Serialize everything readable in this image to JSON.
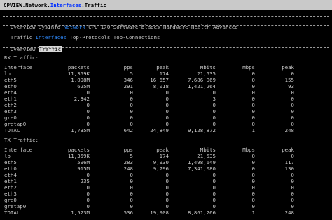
{
  "title": {
    "prefix": "CPVIEW.Network.",
    "highlight": "Interfaces",
    "suffix": ".Traffic"
  },
  "menu1": {
    "before": "Overview SysInfo ",
    "selected": "Network",
    "after": " CPU I/O Software-blades Hardware-Health Advanced"
  },
  "menu2": {
    "before": "Traffic ",
    "selected": "Interfaces",
    "after": " Top-Protocols Top-Connections"
  },
  "menu3": {
    "before": "Overview ",
    "selected": "Traffic"
  },
  "headers": [
    "Interface",
    "packets",
    "pps",
    "peak",
    "Mbits",
    "Mbps",
    "peak"
  ],
  "rx": {
    "label": "RX Traffic:",
    "rows": [
      [
        "lo",
        "11,359K",
        "5",
        "174",
        "21,535",
        "0",
        "0"
      ],
      [
        "eth5",
        "1,098M",
        "346",
        "16,657",
        "7,686,069",
        "0",
        "155"
      ],
      [
        "eth0",
        "625M",
        "291",
        "8,018",
        "1,421,264",
        "0",
        "93"
      ],
      [
        "eth4",
        "0",
        "0",
        "0",
        "0",
        "0",
        "0"
      ],
      [
        "eth1",
        "2,342",
        "0",
        "0",
        "3",
        "0",
        "0"
      ],
      [
        "eth2",
        "0",
        "0",
        "0",
        "0",
        "0",
        "0"
      ],
      [
        "eth3",
        "0",
        "0",
        "0",
        "0",
        "0",
        "0"
      ],
      [
        "gre0",
        "0",
        "0",
        "0",
        "0",
        "0",
        "0"
      ],
      [
        "gretap0",
        "0",
        "0",
        "0",
        "0",
        "0",
        "0"
      ],
      [
        "TOTAL",
        "1,735M",
        "642",
        "24,849",
        "9,128,872",
        "1",
        "248"
      ]
    ]
  },
  "tx": {
    "label": "TX Traffic:",
    "rows": [
      [
        "lo",
        "11,359K",
        "5",
        "174",
        "21,535",
        "0",
        "0"
      ],
      [
        "eth5",
        "596M",
        "283",
        "9,930",
        "1,498,649",
        "0",
        "117"
      ],
      [
        "eth0",
        "915M",
        "248",
        "9,796",
        "7,341,080",
        "0",
        "130"
      ],
      [
        "eth4",
        "0",
        "0",
        "0",
        "0",
        "0",
        "0"
      ],
      [
        "eth1",
        "235",
        "0",
        "0",
        "0",
        "0",
        "0"
      ],
      [
        "eth2",
        "0",
        "0",
        "0",
        "0",
        "0",
        "0"
      ],
      [
        "eth3",
        "0",
        "0",
        "0",
        "0",
        "0",
        "0"
      ],
      [
        "gre0",
        "0",
        "0",
        "0",
        "0",
        "0",
        "0"
      ],
      [
        "gretap0",
        "0",
        "0",
        "0",
        "0",
        "0",
        "0"
      ],
      [
        "TOTAL",
        "1,523M",
        "536",
        "19,908",
        "8,861,266",
        "1",
        "248"
      ]
    ]
  }
}
